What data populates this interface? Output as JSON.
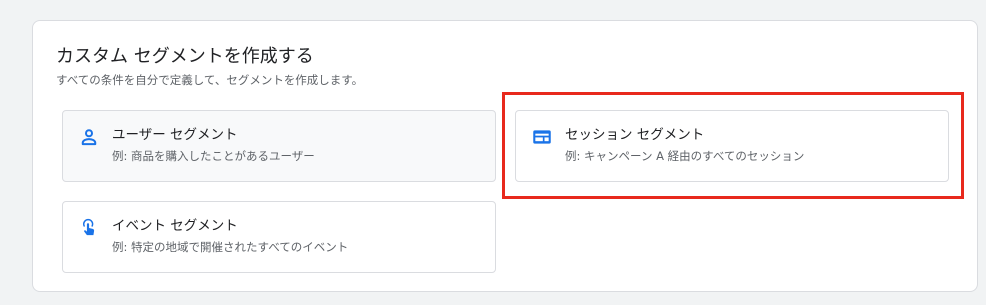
{
  "panel": {
    "title": "カスタム セグメントを作成する",
    "subtitle": "すべての条件を自分で定義して、セグメントを作成します。"
  },
  "cards": {
    "user": {
      "title": "ユーザー セグメント",
      "description": "例: 商品を購入したことがあるユーザー",
      "icon": "person-icon"
    },
    "session": {
      "title": "セッション セグメント",
      "description": "例: キャンペーン A 経由のすべてのセッション",
      "icon": "session-icon"
    },
    "event": {
      "title": "イベント セグメント",
      "description": "例: 特定の地域で開催されたすべてのイベント",
      "icon": "touch-icon"
    }
  },
  "colors": {
    "accent": "#1a73e8",
    "highlight": "#e8291d"
  }
}
